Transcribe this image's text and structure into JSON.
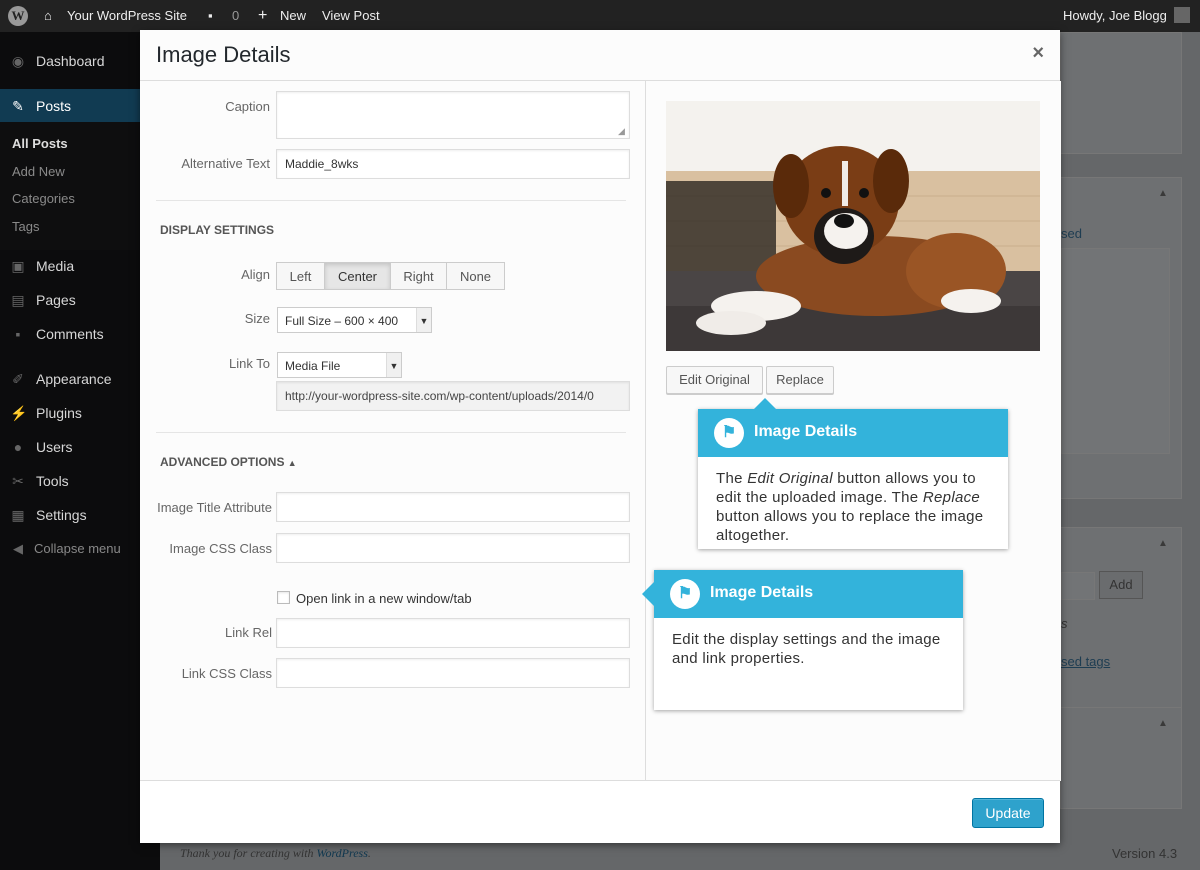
{
  "adminbar": {
    "site_name": "Your WordPress Site",
    "comments_count": "0",
    "new_label": "New",
    "view_post": "View Post",
    "howdy": "Howdy, Joe Blogg"
  },
  "sidebar": {
    "dashboard": "Dashboard",
    "posts": "Posts",
    "sub": [
      "All Posts",
      "Add New",
      "Categories",
      "Tags"
    ],
    "media": "Media",
    "pages": "Pages",
    "comments": "Comments",
    "appearance": "Appearance",
    "plugins": "Plugins",
    "users": "Users",
    "tools": "Tools",
    "settings": "Settings",
    "collapse": "Collapse menu"
  },
  "background": {
    "partial_link1": "sed",
    "add_btn": "Add",
    "partial_text": "s",
    "partial_link2": "sed tags",
    "thanks_prefix": "Thank you for creating with ",
    "thanks_link": "WordPress",
    "thanks_suffix": ".",
    "version": "Version 4.3"
  },
  "modal": {
    "title": "Image Details",
    "close": "×",
    "caption_label": "Caption",
    "caption_value": "",
    "alt_label": "Alternative Text",
    "alt_value": "Maddie_8wks",
    "display_settings": "DISPLAY SETTINGS",
    "align_label": "Align",
    "align_options": [
      "Left",
      "Center",
      "Right",
      "None"
    ],
    "align_selected": "Center",
    "size_label": "Size",
    "size_value": "Full Size – 600 × 400",
    "link_to_label": "Link To",
    "link_to_value": "Media File",
    "link_url": "http://your-wordpress-site.com/wp-content/uploads/2014/0",
    "advanced_options": "ADVANCED OPTIONS",
    "title_attr_label": "Image Title Attribute",
    "css_class_label": "Image CSS Class",
    "new_window_label": "Open link in a new window/tab",
    "link_rel_label": "Link Rel",
    "link_css_label": "Link CSS Class",
    "edit_original": "Edit Original",
    "replace": "Replace",
    "update": "Update"
  },
  "callouts": {
    "top": {
      "title": "Image Details",
      "body_1": "The ",
      "body_em1": "Edit Original",
      "body_2": " button allows you to edit the uploaded image. The ",
      "body_em2": "Replace",
      "body_3": " button allows you to replace the image altogether."
    },
    "bottom": {
      "title": "Image Details",
      "body": "Edit the display settings and the image and link properties."
    }
  },
  "colors": {
    "accent": "#33b3db",
    "primary_button": "#2ea2cc",
    "admin_bar": "#222222",
    "sidebar": "#0c0c0d",
    "current_menu": "#113b52"
  }
}
